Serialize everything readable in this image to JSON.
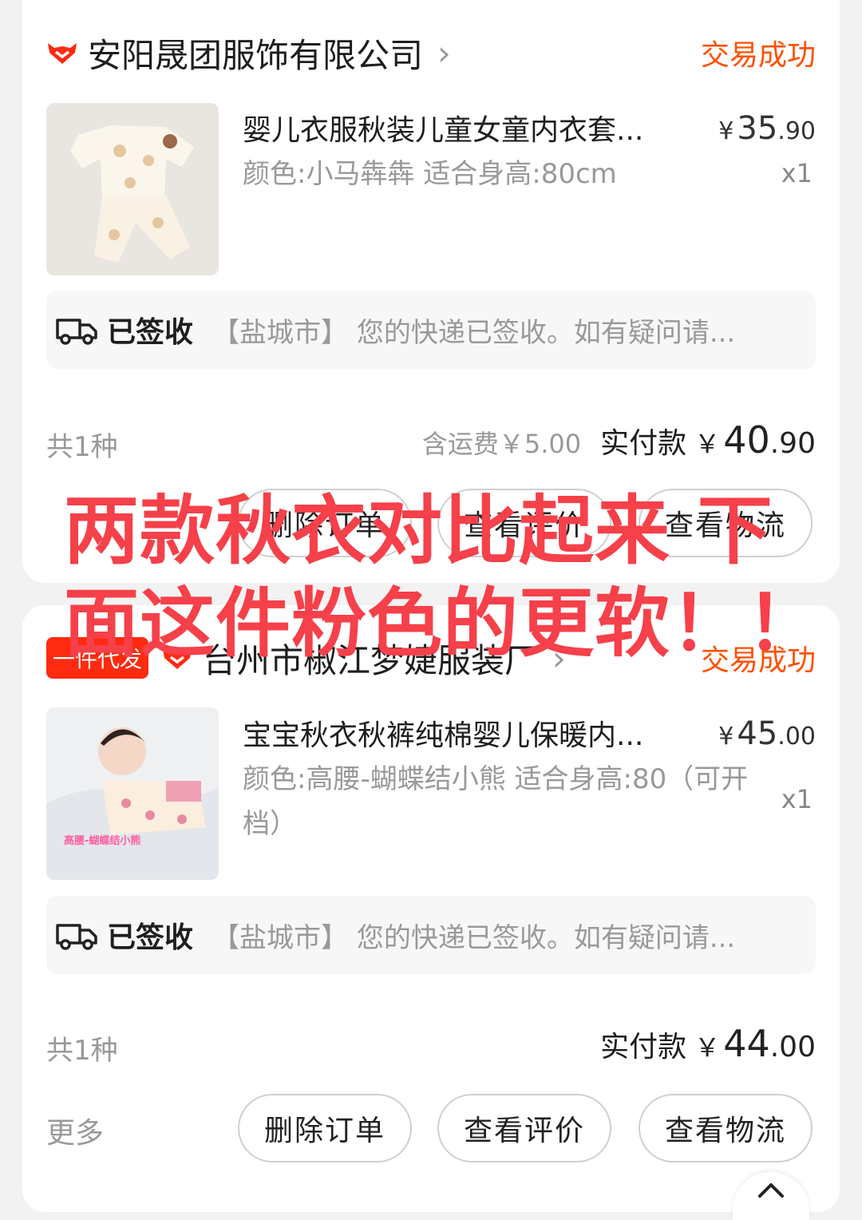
{
  "orders": [
    {
      "shop_name": "安阳晟团服饰有限公司",
      "status": "交易成功",
      "product_title": "婴儿衣服秋装儿童女童内衣套...",
      "price_yen": "¥",
      "price_int": "35",
      "price_dec": ".90",
      "sku": "颜色:小马犇犇 适合身高:80cm",
      "qty": "x1",
      "logistics_status": "已签收",
      "logistics_detail": "【盐城市】 您的快递已签收。如有疑问请...",
      "item_count": "共1种",
      "shipping": "含运费￥5.00",
      "paid_label": "实付款",
      "paid_yen": "￥",
      "paid_int": "40",
      "paid_dec": ".90",
      "buttons": [
        "删除订单",
        "查看评价",
        "查看物流"
      ]
    },
    {
      "tag": "一件代发",
      "shop_name": "台州市椒江梦婕服装厂",
      "status": "交易成功",
      "product_title": "宝宝秋衣秋裤纯棉婴儿保暖内...",
      "price_yen": "¥",
      "price_int": "45",
      "price_dec": ".00",
      "sku": "颜色:高腰-蝴蝶结小熊 适合身高:80（可开档）",
      "qty": "x1",
      "image_caption": "高腰-蝴蝶结小熊",
      "logistics_status": "已签收",
      "logistics_detail": "【盐城市】 您的快递已签收。如有疑问请...",
      "item_count": "共1种",
      "paid_label": "实付款",
      "paid_yen": "￥",
      "paid_int": "44",
      "paid_dec": ".00",
      "more": "更多",
      "buttons": [
        "删除订单",
        "查看评价",
        "查看物流"
      ]
    }
  ],
  "overlay_text": "两款秋衣对比起来 下面这件粉色的更软！！",
  "colors": {
    "accent": "#ff5000",
    "overlay": "#f6404a",
    "tag_bg": "#ff2a10"
  },
  "icons": {
    "shop": "tmall-cat-icon",
    "logistics": "truck-icon",
    "scroll": "chevron-up-icon"
  }
}
